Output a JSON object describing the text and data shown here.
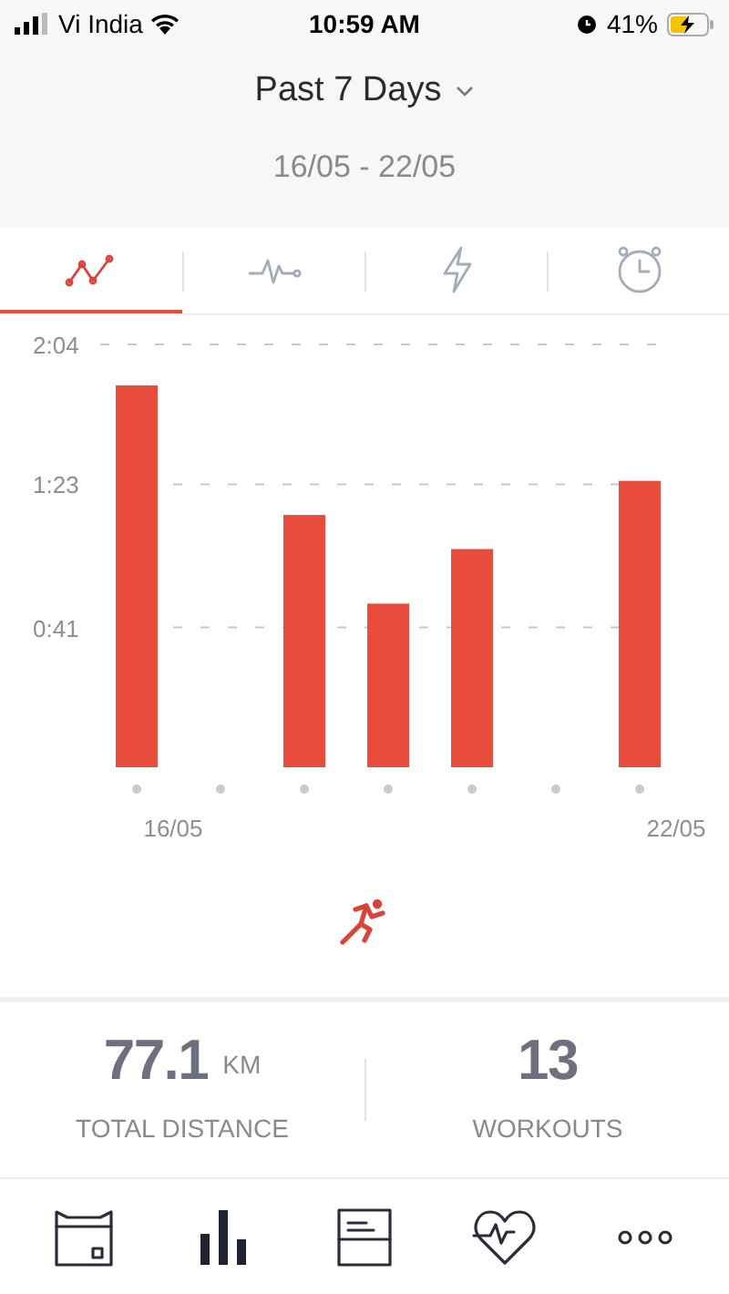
{
  "status_bar": {
    "carrier": "Vi India",
    "time": "10:59 AM",
    "battery": "41%"
  },
  "header": {
    "period": "Past 7 Days",
    "range": "16/05 - 22/05"
  },
  "tabs": [
    {
      "kind": "trend",
      "selected": true
    },
    {
      "kind": "pulse",
      "selected": false
    },
    {
      "kind": "bolt",
      "selected": false
    },
    {
      "kind": "alarm",
      "selected": false
    }
  ],
  "chart": {
    "chart_data": {
      "type": "bar",
      "categories": [
        "16/05",
        null,
        null,
        null,
        null,
        null,
        "22/05"
      ],
      "series": [
        {
          "color": "#e84c3d",
          "values": [
            112,
            null,
            74,
            48,
            64,
            null,
            84
          ]
        }
      ],
      "ylim": [
        0,
        124
      ],
      "yticks": [
        {
          "value": 41,
          "label": "0:41"
        },
        {
          "value": 83,
          "label": "1:23"
        },
        {
          "value": 124,
          "label": "2:04"
        }
      ]
    }
  },
  "stats": [
    {
      "value": "77.1",
      "unit": "KM",
      "label": "TOTAL DISTANCE"
    },
    {
      "value": "13",
      "label": "WORKOUTS"
    }
  ],
  "nav": [
    {
      "kind": "calendar",
      "selected": false
    },
    {
      "kind": "bars",
      "selected": true
    },
    {
      "kind": "list",
      "selected": false
    },
    {
      "kind": "heart",
      "selected": false
    },
    {
      "kind": "more",
      "selected": false
    }
  ]
}
